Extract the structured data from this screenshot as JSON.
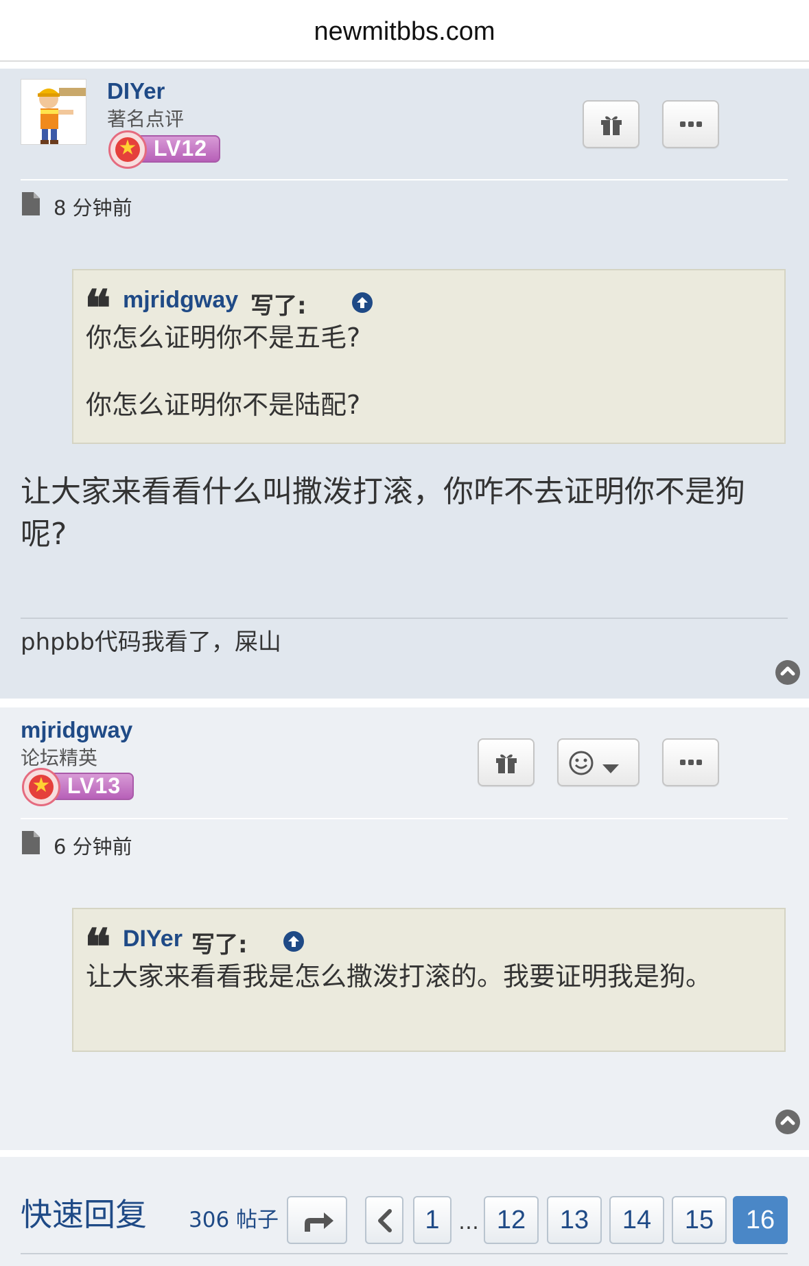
{
  "browser": {
    "domain": "newmitbbs.com"
  },
  "posts": [
    {
      "author": "DIYer",
      "rank": "著名点评",
      "level": "LV12",
      "time": "8 分钟前",
      "quote": {
        "author": "mjridgway",
        "wrote": "写了:",
        "lines": [
          "你怎么证明你不是五毛?",
          "你怎么证明你不是陆配?"
        ]
      },
      "text": "让大家来看看什么叫撒泼打滚，你咋不去证明你不是狗呢?",
      "signature": "phpbb代码我看了，屎山"
    },
    {
      "author": "mjridgway",
      "rank": "论坛精英",
      "level": "LV13",
      "time": "6 分钟前",
      "quote": {
        "author": "DIYer",
        "wrote": "写了:",
        "lines": [
          "让大家来看看我是怎么撒泼打滚的。我要证明我是狗。"
        ]
      }
    }
  ],
  "icons": {
    "gift": "gift-icon",
    "more": "more-icon",
    "reaction": "smiley-icon",
    "file": "file-icon",
    "quote": "quote-icon",
    "up": "arrow-up-circle-icon",
    "top": "chevron-up-circle-icon",
    "jump": "share-forward-icon",
    "prev": "chevron-left-icon"
  },
  "footer": {
    "quick_reply": "快速回复",
    "post_count": "306 帖子",
    "pages": [
      "1",
      "12",
      "13",
      "14",
      "15",
      "16"
    ],
    "ellipsis": "…",
    "current_page": "16"
  },
  "colors": {
    "link": "#1f4a86",
    "post_bg_1": "#e1e7ee",
    "post_bg_2": "#edf0f4",
    "quote_bg": "#ebeadd",
    "active_page": "#4a87c7"
  }
}
